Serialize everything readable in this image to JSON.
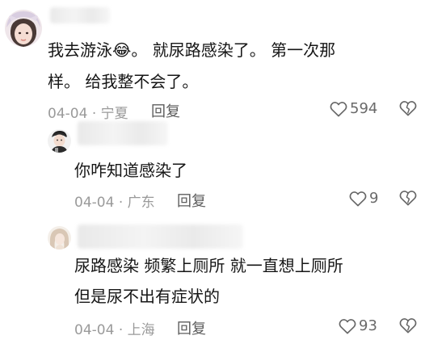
{
  "comments": [
    {
      "text_line1_a": "我去游泳",
      "emoji": "😂",
      "text_line1_b": "。  就尿路感染了。 第一次那",
      "text_line2": "样。 给我整不会了。",
      "date": "04-04",
      "region": "宁夏",
      "reply_label": "回复",
      "like_count": "594"
    },
    {
      "text_line1": "你咋知道感染了",
      "date": "04-04",
      "region": "广东",
      "reply_label": "回复",
      "like_count": "9"
    },
    {
      "text_line1": "尿路感染  频繁上厕所  就一直想上厕所",
      "text_line2": "但是尿不出有症状的",
      "date": "04-04",
      "region": "上海",
      "reply_label": "回复",
      "like_count": "93"
    }
  ],
  "meta_separator": "·",
  "icons": {
    "like": "heart-outline-icon",
    "dislike": "broken-heart-icon"
  },
  "colors": {
    "text": "#161616",
    "meta": "#9a9a9a",
    "reply": "#5c5c5c"
  }
}
